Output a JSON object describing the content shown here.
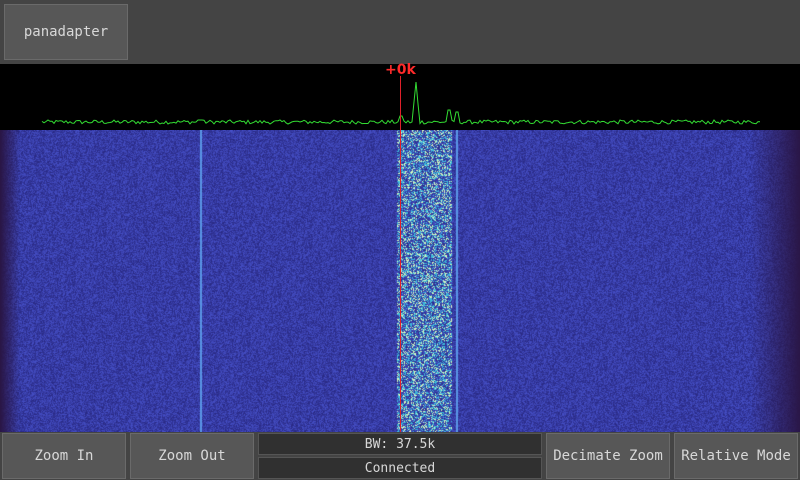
{
  "top_bar": {
    "panadapter_label": "panadapter"
  },
  "spectrum": {
    "center_label": "+0k",
    "trace_color": "#33dd33",
    "marker_color": "#e0202a"
  },
  "status": {
    "bandwidth": "BW: 37.5k",
    "connection": "Connected"
  },
  "bottom_bar": {
    "zoom_in_label": "Zoom In",
    "zoom_out_label": "Zoom Out",
    "decimate_zoom_label": "Decimate Zoom",
    "relative_mode_label": "Relative Mode"
  },
  "colors": {
    "waterfall_base": "#2e2a8a",
    "waterfall_edge": "#2a1646",
    "background": "#444444"
  }
}
